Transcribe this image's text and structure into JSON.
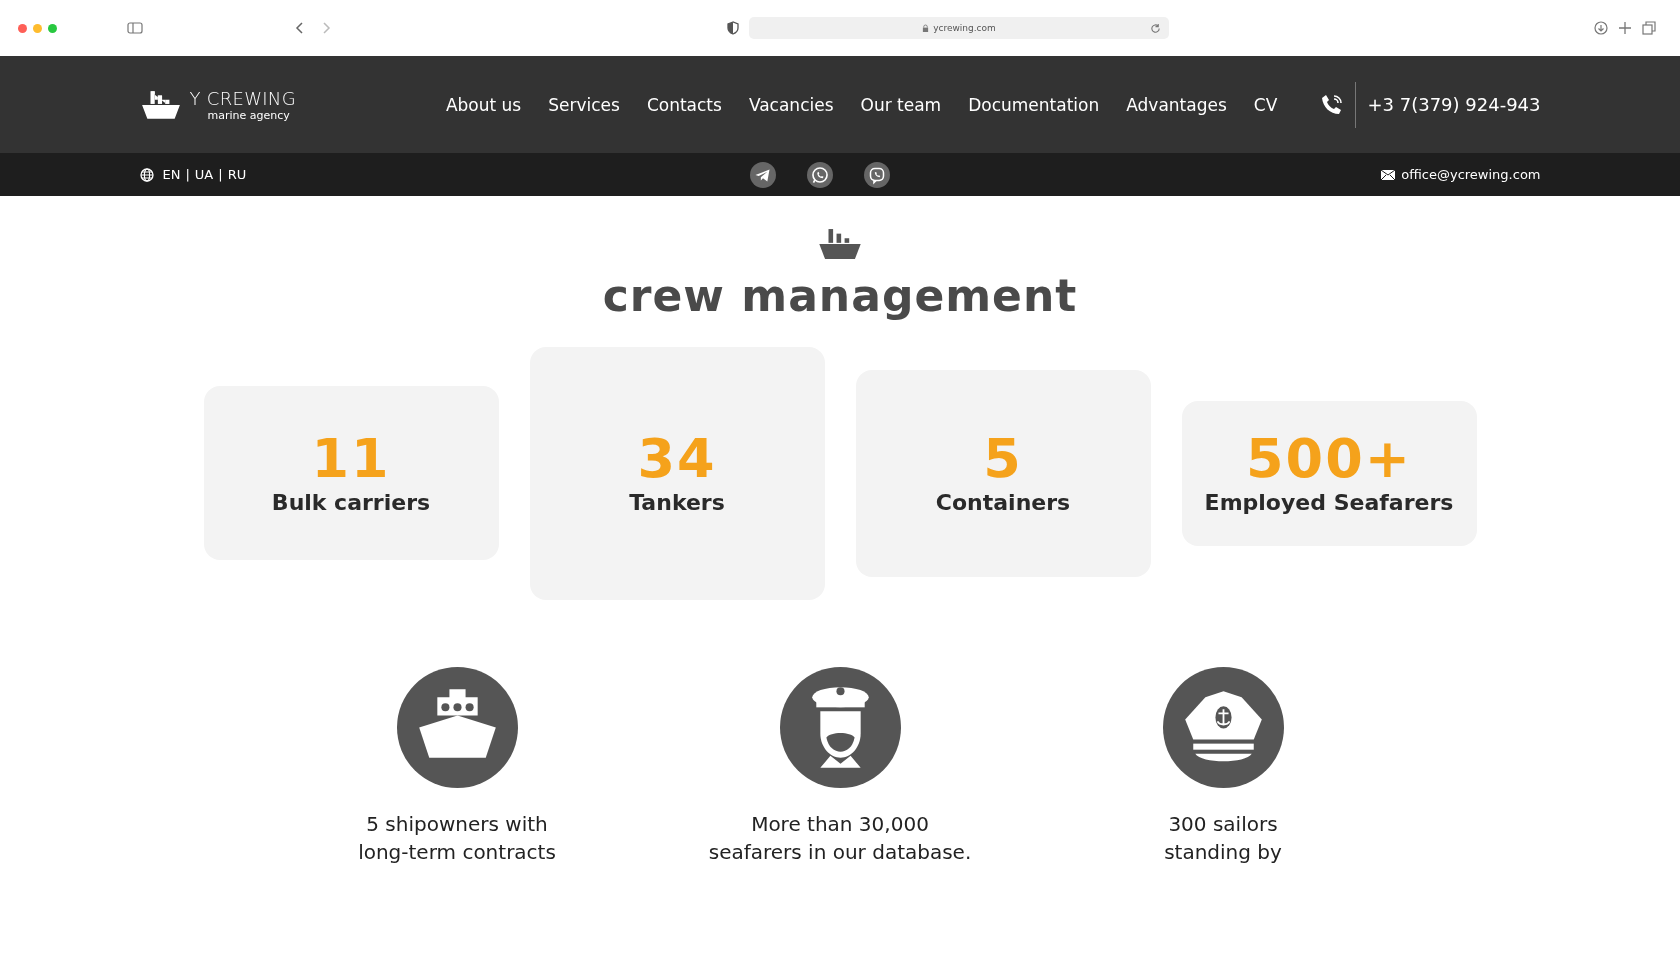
{
  "browser": {
    "url": "ycrewing.com"
  },
  "header": {
    "logo": {
      "name": "Y CREWING",
      "tagline": "marine agency"
    },
    "nav": [
      {
        "label": "About us"
      },
      {
        "label": "Services"
      },
      {
        "label": "Contacts"
      },
      {
        "label": "Vacancies"
      },
      {
        "label": "Our team"
      },
      {
        "label": "Documentation"
      },
      {
        "label": "Advantages"
      },
      {
        "label": "CV"
      }
    ],
    "phone": "+3 7(379) 924-943"
  },
  "subbar": {
    "languages": [
      "EN",
      "UA",
      "RU"
    ],
    "separators": [
      "|",
      "|"
    ],
    "socials": [
      {
        "kind": "telegram"
      },
      {
        "kind": "whatsapp"
      },
      {
        "kind": "viber"
      }
    ],
    "email": "office@ycrewing.com"
  },
  "section": {
    "title": "crew management",
    "stats": [
      {
        "value": "11",
        "label": "Bulk carriers"
      },
      {
        "value": "34",
        "label": "Tankers"
      },
      {
        "value": "5",
        "label": "Containers"
      },
      {
        "value": "500+",
        "label": "Employed Seafarers"
      }
    ],
    "features": [
      {
        "kind": "ship",
        "lines": [
          "5 shipowners with",
          "long-term contracts"
        ]
      },
      {
        "kind": "captain",
        "lines": [
          "More than 30,000",
          "seafarers in our database."
        ]
      },
      {
        "kind": "cap",
        "lines": [
          "300 sailors",
          "standing by"
        ]
      }
    ]
  }
}
